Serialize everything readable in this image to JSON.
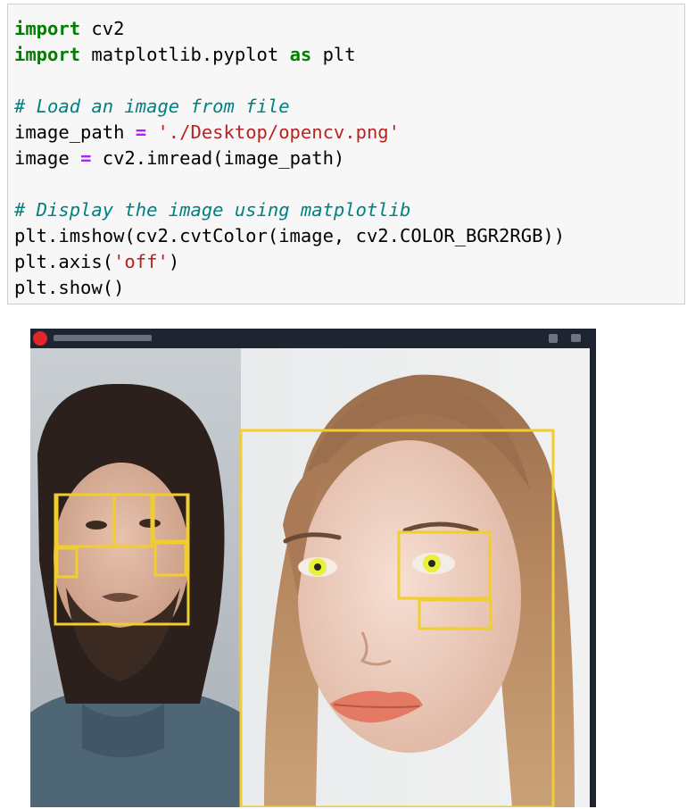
{
  "code_cell": {
    "lines": [
      {
        "tokens": [
          {
            "t": "import",
            "c": "kw"
          },
          {
            "t": " cv2",
            "c": ""
          }
        ]
      },
      {
        "tokens": [
          {
            "t": "import",
            "c": "kw"
          },
          {
            "t": " matplotlib.pyplot ",
            "c": ""
          },
          {
            "t": "as",
            "c": "kw"
          },
          {
            "t": " plt",
            "c": ""
          }
        ]
      },
      {
        "tokens": []
      },
      {
        "tokens": [
          {
            "t": "# Load an image from file",
            "c": "cmt"
          }
        ]
      },
      {
        "tokens": [
          {
            "t": "image_path ",
            "c": ""
          },
          {
            "t": "=",
            "c": "op"
          },
          {
            "t": " ",
            "c": ""
          },
          {
            "t": "'./Desktop/opencv.png'",
            "c": "str"
          }
        ]
      },
      {
        "tokens": [
          {
            "t": "image ",
            "c": ""
          },
          {
            "t": "=",
            "c": "op"
          },
          {
            "t": " cv2.imread(image_path)",
            "c": ""
          }
        ]
      },
      {
        "tokens": []
      },
      {
        "tokens": [
          {
            "t": "# Display the image using matplotlib",
            "c": "cmt"
          }
        ]
      },
      {
        "tokens": [
          {
            "t": "plt.imshow(cv2.cvtColor(image, cv2.COLOR_BGR2RGB))",
            "c": ""
          }
        ]
      },
      {
        "tokens": [
          {
            "t": "plt.axis(",
            "c": ""
          },
          {
            "t": "'off'",
            "c": "str"
          },
          {
            "t": ")",
            "c": ""
          }
        ]
      },
      {
        "tokens": [
          {
            "t": "plt.show()",
            "c": ""
          }
        ]
      }
    ]
  },
  "output": {
    "figure_window_title": "",
    "detection_box_color": "#f2cd2e",
    "detected_eye_color": "#e8f03a",
    "window_controls": [
      "record-icon",
      "settings-icon",
      "chat-icon"
    ]
  }
}
